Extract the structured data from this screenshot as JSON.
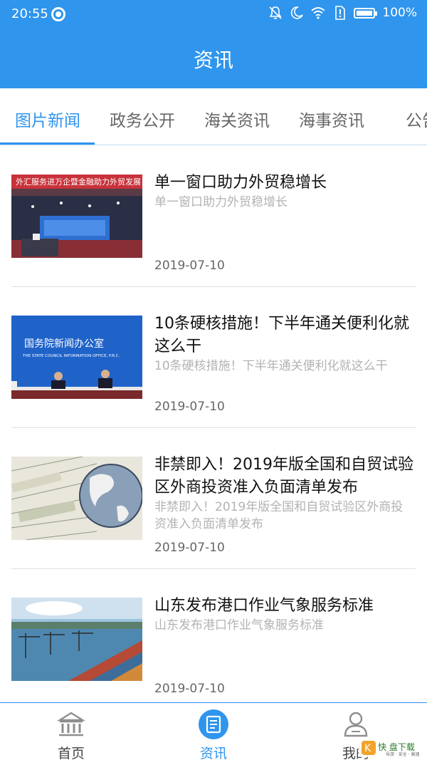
{
  "status_bar": {
    "time": "20:55",
    "battery": "100%"
  },
  "header": {
    "title": "资讯"
  },
  "tabs": [
    {
      "label": "图片新闻",
      "active": true
    },
    {
      "label": "政务公开",
      "active": false
    },
    {
      "label": "海关资讯",
      "active": false
    },
    {
      "label": "海事资讯",
      "active": false
    },
    {
      "label": "公告",
      "active": false
    }
  ],
  "thumbs": {
    "first_banner": "外汇服务进万企暨金融助力外贸发展",
    "second_line1": "国务院新闻办公室",
    "second_line2": "THE STATE COUNCIL INFORMATION OFFICE, P.R.C."
  },
  "news": [
    {
      "title": "单一窗口助力外贸稳增长",
      "subtitle": "单一窗口助力外贸稳增长",
      "date": "2019-07-10",
      "image": "conference-photo"
    },
    {
      "title": "10条硬核措施！下半年通关便利化就这么干",
      "subtitle": "10条硬核措施！下半年通关便利化就这么干",
      "date": "2019-07-10",
      "image": "press-conference-photo"
    },
    {
      "title": "非禁即入！2019年版全国和自贸试验区外商投资准入负面清单发布",
      "subtitle": "非禁即入！2019年版全国和自贸试验区外商投资准入负面清单发布",
      "date": "2019-07-10",
      "image": "globe-money-photo"
    },
    {
      "title": "山东发布港口作业气象服务标准",
      "subtitle": "山东发布港口作业气象服务标准",
      "date": "2019-07-10",
      "image": "port-photo"
    }
  ],
  "bottom_nav": [
    {
      "label": "首页",
      "icon": "bank-icon",
      "active": false
    },
    {
      "label": "资讯",
      "icon": "news-icon",
      "active": true
    },
    {
      "label": "我的",
      "icon": "user-icon",
      "active": false
    }
  ],
  "watermark": {
    "main": "快 盘下载",
    "sub": "导游 · 安全 · 高速"
  },
  "colors": {
    "primary": "#2f95ed",
    "text": "#111111",
    "muted": "#b3b3b3"
  }
}
